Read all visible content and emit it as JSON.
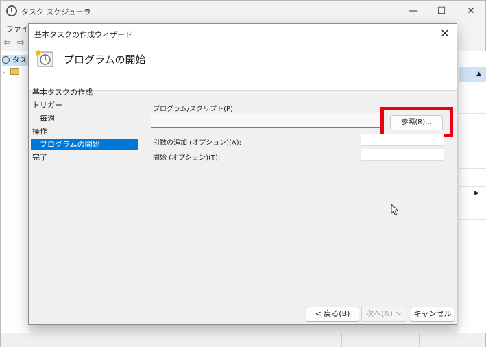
{
  "main_window": {
    "title": "タスク スケジューラ",
    "menu_first": "ファイル",
    "tree_item": "タス",
    "controls": {
      "minimize": "—",
      "maximize": "☐",
      "close": "✕"
    },
    "nav_back": "⇦",
    "nav_forward": "⇨"
  },
  "dialog": {
    "title": "基本タスクの作成ウィザード",
    "close": "✕",
    "header_title": "プログラムの開始",
    "steps": [
      {
        "label": "基本タスクの作成"
      },
      {
        "label": "トリガー"
      },
      {
        "label": "毎週"
      },
      {
        "label": "操作"
      },
      {
        "label": "プログラムの開始"
      },
      {
        "label": "完了"
      }
    ],
    "active_step": "プログラムの開始",
    "form": {
      "program_label": "プログラム/スクリプト(P):",
      "program_value": "",
      "browse_label": "参照(R)...",
      "args_label": "引数の追加 (オプション)(A):",
      "args_value": "",
      "start_label": "開始 (オプション)(T):",
      "start_value": ""
    },
    "buttons": {
      "back": "< 戻る(B)",
      "next": "次へ(N) >",
      "cancel": "キャンセル"
    }
  },
  "colors": {
    "highlight": "#e8000c",
    "selection": "#0078d7"
  }
}
